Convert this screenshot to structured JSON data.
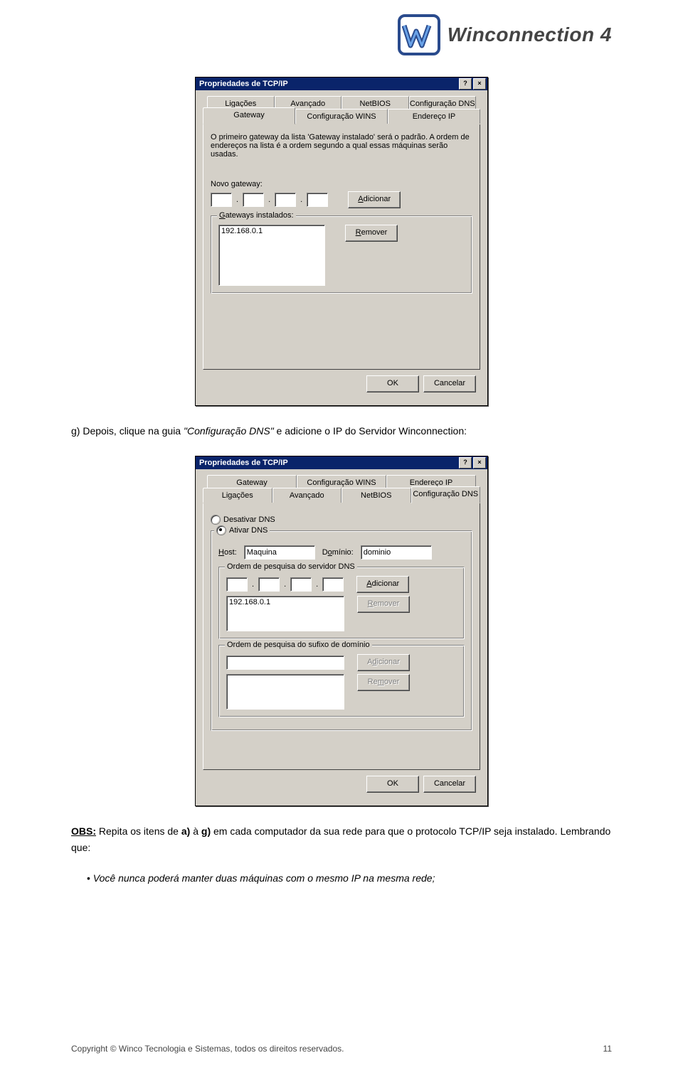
{
  "brand": "Winconnection 4",
  "dlg1": {
    "title": "Propriedades de TCP/IP",
    "tabs_back": [
      "Ligações",
      "Avançado",
      "NetBIOS",
      "Configuração DNS"
    ],
    "tabs_front": [
      "Gateway",
      "Configuração WINS",
      "Endereço IP"
    ],
    "help": "O primeiro gateway da lista 'Gateway instalado' será o padrão. A ordem de endereços na lista é a ordem segundo a qual essas máquinas serão usadas.",
    "novo_label": "Novo gateway:",
    "add": "Adicionar",
    "installed_label": "Gateways instalados:",
    "item": "192.168.0.1",
    "remove": "Remover",
    "ok": "OK",
    "cancel": "Cancelar"
  },
  "p_g": "g) Depois, clique na guia \"Configuração DNS\" e adicione o IP do Servidor Winconnection:",
  "dlg2": {
    "title": "Propriedades de TCP/IP",
    "tabs_back": [
      "Gateway",
      "Configuração WINS",
      "Endereço IP"
    ],
    "tabs_front": [
      "Ligações",
      "Avançado",
      "NetBIOS",
      "Configuração DNS"
    ],
    "r_off": "Desativar DNS",
    "r_on": "Ativar DNS",
    "host_l": "Host:",
    "host_v": "Maquina",
    "dom_l": "Domínio:",
    "dom_v": "dominio",
    "g1": "Ordem de pesquisa do servidor DNS",
    "add": "Adicionar",
    "item": "192.168.0.1",
    "remove": "Remover",
    "g2": "Ordem de pesquisa do sufixo de domínio",
    "add2": "Adicionar",
    "remove2": "Remover",
    "ok": "OK",
    "cancel": "Cancelar"
  },
  "p_obs_label": "OBS:",
  "p_obs": " Repita os itens de ",
  "p_obs_b1": "a)",
  "p_obs_mid": " à ",
  "p_obs_b2": "g)",
  "p_obs_end": " em cada computador da sua rede para que o protocolo TCP/IP seja instalado. Lembrando que:",
  "bullet": "Você nunca poderá manter duas máquinas com o mesmo IP na mesma rede;",
  "footer": "Copyright © Winco Tecnologia e Sistemas, todos os direitos reservados.",
  "pagenum": "11"
}
